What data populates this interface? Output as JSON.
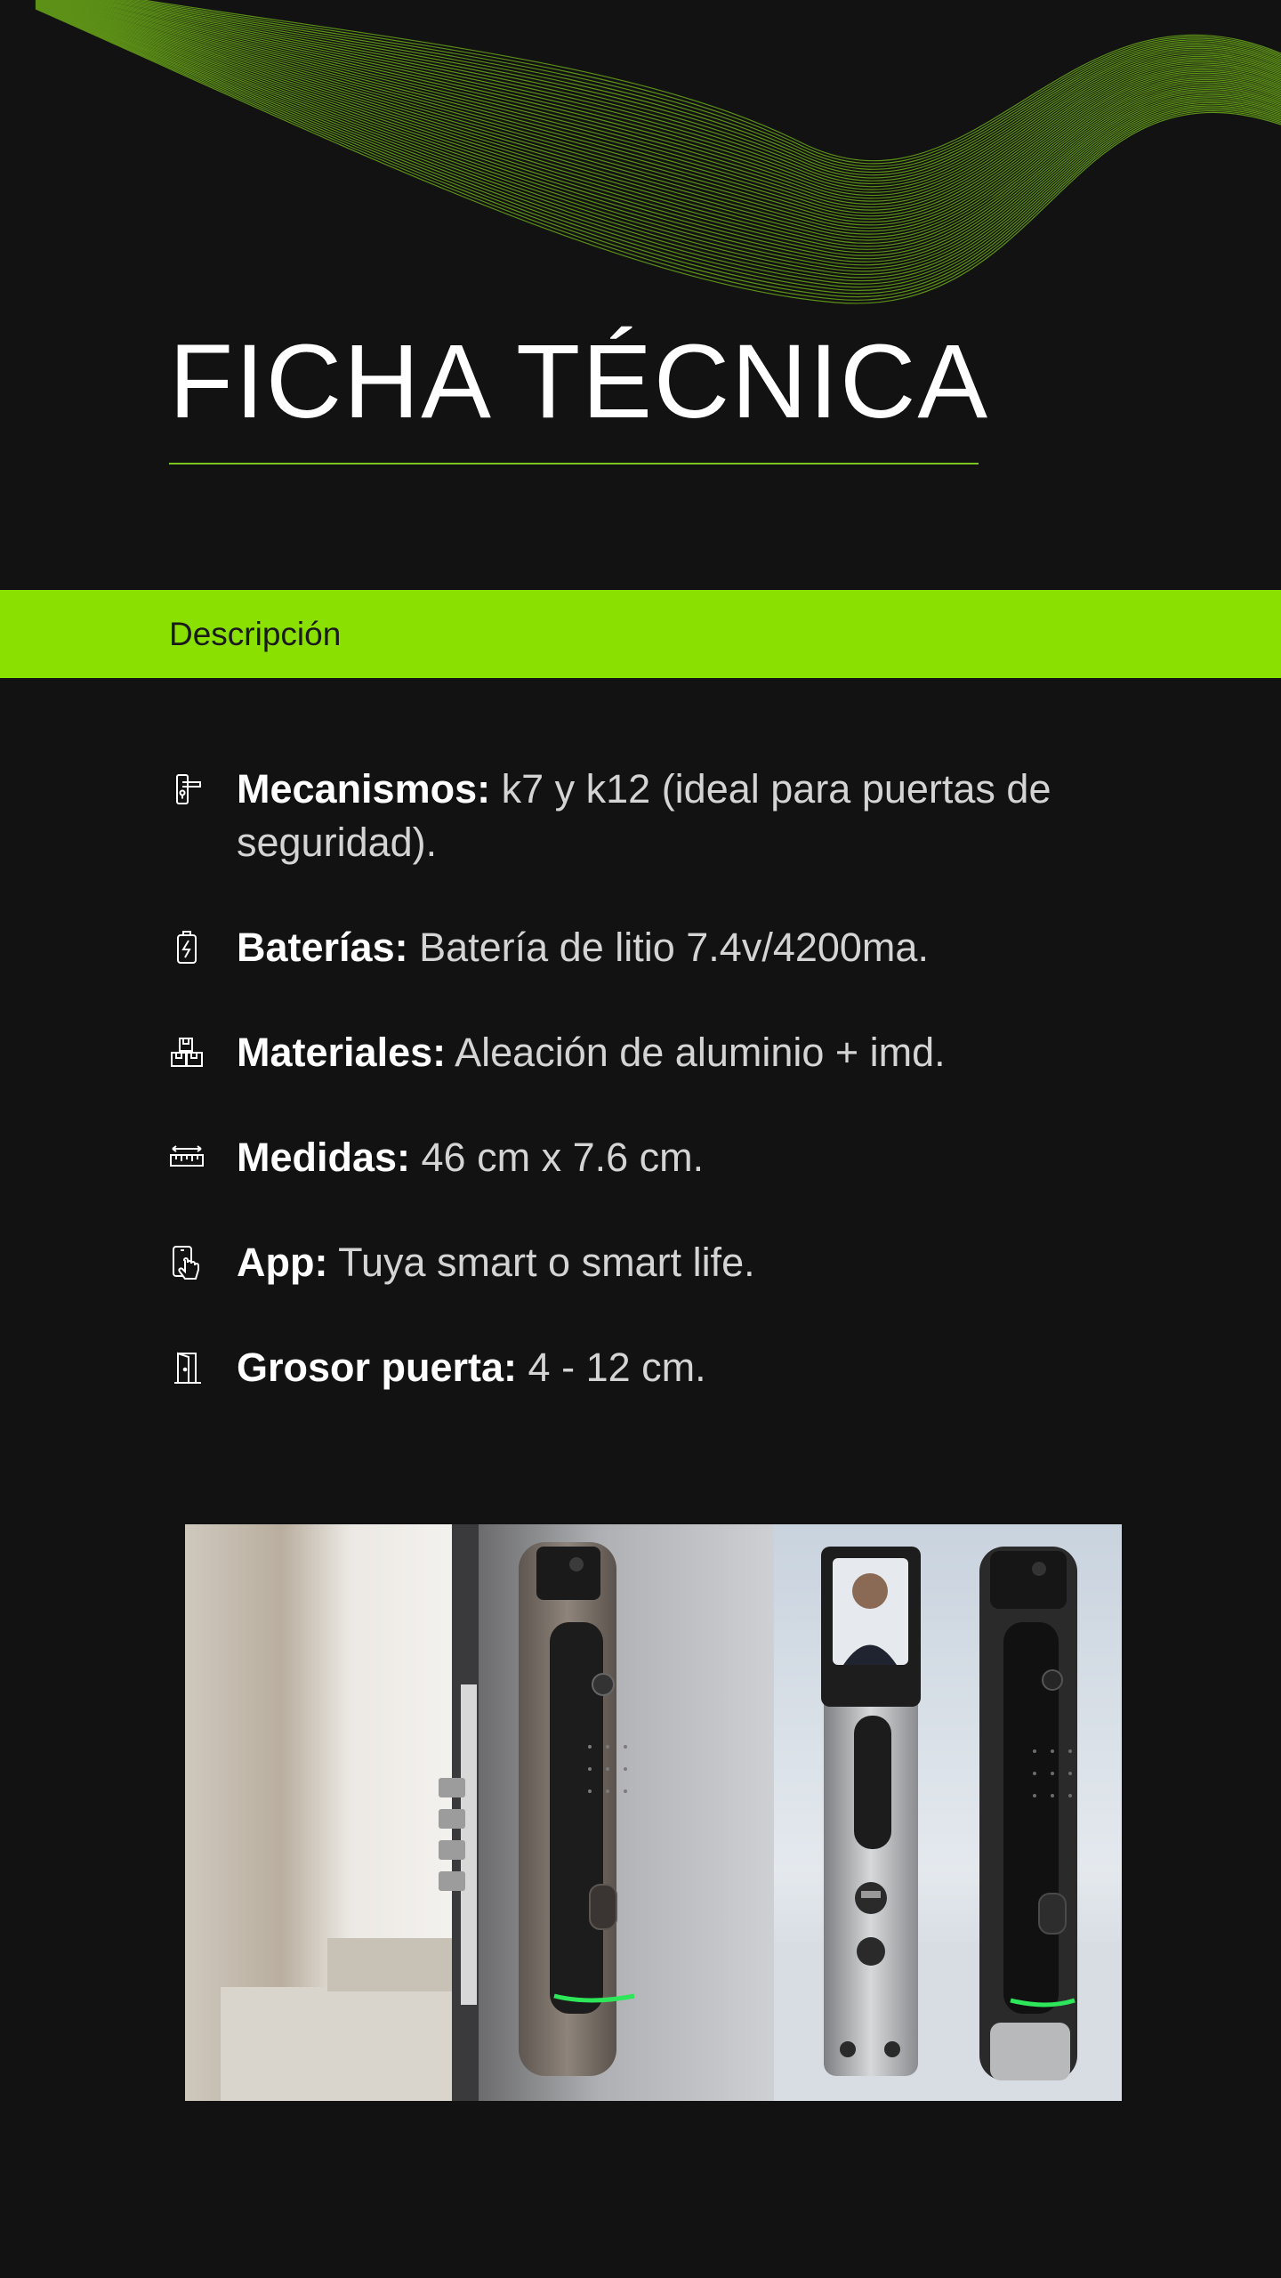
{
  "header": {
    "title": "FICHA TÉCNICA"
  },
  "section": {
    "label": "Descripción"
  },
  "specs": [
    {
      "icon": "door-handle-icon",
      "label": "Mecanismos:",
      "value": " k7 y k12 (ideal para puertas de seguridad)."
    },
    {
      "icon": "battery-icon",
      "label": "Baterías:",
      "value": " Batería de litio 7.4v/4200ma."
    },
    {
      "icon": "boxes-icon",
      "label": "Materiales:",
      "value": " Aleación de aluminio + imd."
    },
    {
      "icon": "ruler-icon",
      "label": "Medidas:",
      "value": " 46 cm x 7.6 cm."
    },
    {
      "icon": "phone-touch-icon",
      "label": "App:",
      "value": " Tuya smart o smart life."
    },
    {
      "icon": "door-icon",
      "label": "Grosor puerta:",
      "value": " 4 - 12 cm."
    }
  ],
  "colors": {
    "background": "#121212",
    "accent": "#8ae000",
    "line": "#7bc61e",
    "text": "#ffffff",
    "muted_text": "#d4d4d4"
  }
}
